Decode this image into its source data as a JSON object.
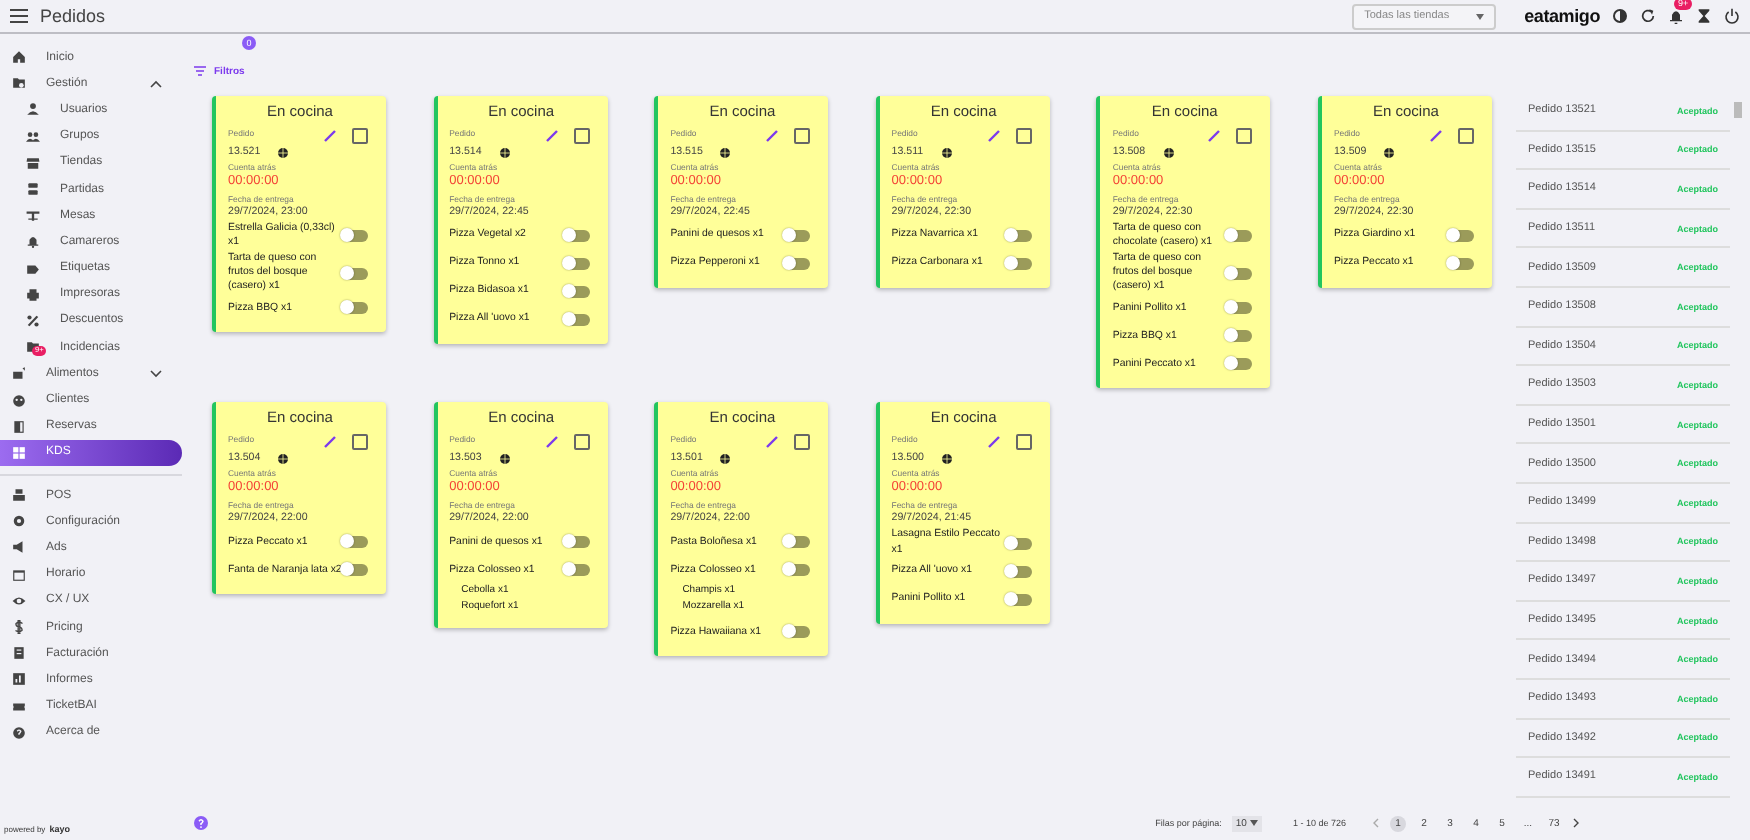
{
  "header": {
    "title": "Pedidos",
    "store_select": {
      "value": "Todas las tiendas"
    },
    "brand": "eatamigo",
    "notification_badge": "9+"
  },
  "sidebar": {
    "items": [
      {
        "label": "Inicio",
        "selected": false
      },
      {
        "label": "Gestión",
        "selected": false,
        "expanded": true,
        "children": [
          {
            "label": "Usuarios",
            "selected": false
          },
          {
            "label": "Grupos",
            "selected": false
          },
          {
            "label": "Tiendas",
            "selected": false
          },
          {
            "label": "Partidas",
            "selected": false
          },
          {
            "label": "Mesas",
            "selected": false
          },
          {
            "label": "Camareros",
            "selected": false
          },
          {
            "label": "Etiquetas",
            "selected": false
          },
          {
            "label": "Impresoras",
            "selected": false
          },
          {
            "label": "Descuentos",
            "selected": false
          },
          {
            "label": "Incidencias",
            "selected": false,
            "badge": "9+"
          }
        ]
      },
      {
        "label": "Alimentos",
        "selected": false,
        "expanded": false
      },
      {
        "label": "Clientes",
        "selected": false
      },
      {
        "label": "Reservas",
        "selected": false
      },
      {
        "label": "KDS",
        "selected": true
      }
    ],
    "bottom_items": [
      {
        "label": "POS",
        "selected": false
      },
      {
        "label": "Configuración",
        "selected": false
      },
      {
        "label": "Ads",
        "selected": false
      },
      {
        "label": "Horario",
        "selected": false
      },
      {
        "label": "CX / UX",
        "selected": false
      },
      {
        "label": "Pricing",
        "selected": false
      },
      {
        "label": "Facturación",
        "selected": false
      },
      {
        "label": "Informes",
        "selected": false
      },
      {
        "label": "TicketBAI",
        "selected": false
      },
      {
        "label": "Acerca de",
        "selected": false
      }
    ],
    "footer": {
      "text": "powered by",
      "brand": "kayo"
    }
  },
  "filters": {
    "label": "Filtros",
    "badge": "0"
  },
  "orders": [
    {
      "status": "En cocina",
      "order_label": "Pedido",
      "number": "13.521",
      "countdown_label": "Cuenta atrás",
      "countdown": "00:00:00",
      "delivery_label": "Fecha de entrega",
      "delivery": "29/7/2024, 23:00",
      "checked": false,
      "items": [
        {
          "name": "Estrella Galicia (0,33cl) x1",
          "done": false
        },
        {
          "name": "Tarta de queso con frutos del bosque (casero) x1",
          "done": false
        },
        {
          "name": "Pizza BBQ x1",
          "done": false
        }
      ]
    },
    {
      "status": "En cocina",
      "order_label": "Pedido",
      "number": "13.514",
      "countdown_label": "Cuenta atrás",
      "countdown": "00:00:00",
      "delivery_label": "Fecha de entrega",
      "delivery": "29/7/2024, 22:45",
      "checked": false,
      "items": [
        {
          "name": "Pizza Vegetal x2",
          "done": false
        },
        {
          "name": "Pizza Tonno x1",
          "done": false
        },
        {
          "name": "Pizza Bidasoa x1",
          "done": false
        },
        {
          "name": "Pizza All 'uovo x1",
          "done": false
        }
      ]
    },
    {
      "status": "En cocina",
      "order_label": "Pedido",
      "number": "13.515",
      "countdown_label": "Cuenta atrás",
      "countdown": "00:00:00",
      "delivery_label": "Fecha de entrega",
      "delivery": "29/7/2024, 22:45",
      "checked": false,
      "items": [
        {
          "name": "Panini de quesos x1",
          "done": false
        },
        {
          "name": "Pizza Pepperoni x1",
          "done": false
        }
      ]
    },
    {
      "status": "En cocina",
      "order_label": "Pedido",
      "number": "13.511",
      "countdown_label": "Cuenta atrás",
      "countdown": "00:00:00",
      "delivery_label": "Fecha de entrega",
      "delivery": "29/7/2024, 22:30",
      "checked": false,
      "items": [
        {
          "name": "Pizza Navarrica x1",
          "done": false
        },
        {
          "name": "Pizza Carbonara x1",
          "done": false
        }
      ]
    },
    {
      "status": "En cocina",
      "order_label": "Pedido",
      "number": "13.508",
      "countdown_label": "Cuenta atrás",
      "countdown": "00:00:00",
      "delivery_label": "Fecha de entrega",
      "delivery": "29/7/2024, 22:30",
      "checked": false,
      "items": [
        {
          "name": "Tarta de queso con chocolate (casero) x1",
          "done": false
        },
        {
          "name": "Tarta de queso con frutos del bosque (casero) x1",
          "done": false
        },
        {
          "name": "Panini Pollito x1",
          "done": false
        },
        {
          "name": "Pizza BBQ x1",
          "done": false
        },
        {
          "name": "Panini Peccato x1",
          "done": false
        }
      ]
    },
    {
      "status": "En cocina",
      "order_label": "Pedido",
      "number": "13.509",
      "countdown_label": "Cuenta atrás",
      "countdown": "00:00:00",
      "delivery_label": "Fecha de entrega",
      "delivery": "29/7/2024, 22:30",
      "checked": false,
      "items": [
        {
          "name": "Pizza Giardino x1",
          "done": false
        },
        {
          "name": "Pizza Peccato x1",
          "done": false
        }
      ]
    },
    {
      "status": "En cocina",
      "order_label": "Pedido",
      "number": "13.504",
      "countdown_label": "Cuenta atrás",
      "countdown": "00:00:00",
      "delivery_label": "Fecha de entrega",
      "delivery": "29/7/2024, 22:00",
      "checked": false,
      "items": [
        {
          "name": "Pizza Peccato x1",
          "done": false
        },
        {
          "name": "Fanta de Naranja lata x2",
          "done": false
        }
      ]
    },
    {
      "status": "En cocina",
      "order_label": "Pedido",
      "number": "13.503",
      "countdown_label": "Cuenta atrás",
      "countdown": "00:00:00",
      "delivery_label": "Fecha de entrega",
      "delivery": "29/7/2024, 22:00",
      "checked": false,
      "items": [
        {
          "name": "Panini de quesos x1",
          "done": false
        },
        {
          "name": "Pizza Colosseo x1",
          "done": false,
          "extras": [
            "Cebolla x1",
            "Roquefort x1"
          ]
        }
      ]
    },
    {
      "status": "En cocina",
      "order_label": "Pedido",
      "number": "13.501",
      "countdown_label": "Cuenta atrás",
      "countdown": "00:00:00",
      "delivery_label": "Fecha de entrega",
      "delivery": "29/7/2024, 22:00",
      "checked": false,
      "items": [
        {
          "name": "Pasta Boloñesa x1",
          "done": false
        },
        {
          "name": "Pizza Colosseo x1",
          "done": false,
          "extras": [
            "Champis x1",
            "Mozzarella x1"
          ]
        },
        {
          "name": "Pizza Hawaiiana x1",
          "done": false
        }
      ]
    },
    {
      "status": "En cocina",
      "order_label": "Pedido",
      "number": "13.500",
      "countdown_label": "Cuenta atrás",
      "countdown": "00:00:00",
      "delivery_label": "Fecha de entrega",
      "delivery": "29/7/2024, 21:45",
      "checked": false,
      "items": [
        {
          "name": "Lasagna Estilo Peccato x1",
          "done": false
        },
        {
          "name": "Pizza All 'uovo x1",
          "done": false
        },
        {
          "name": "Panini Pollito x1",
          "done": false
        }
      ]
    }
  ],
  "order_list": [
    {
      "name": "Pedido 13521",
      "status": "Aceptado"
    },
    {
      "name": "Pedido 13515",
      "status": "Aceptado"
    },
    {
      "name": "Pedido 13514",
      "status": "Aceptado"
    },
    {
      "name": "Pedido 13511",
      "status": "Aceptado"
    },
    {
      "name": "Pedido 13509",
      "status": "Aceptado"
    },
    {
      "name": "Pedido 13508",
      "status": "Aceptado"
    },
    {
      "name": "Pedido 13504",
      "status": "Aceptado"
    },
    {
      "name": "Pedido 13503",
      "status": "Aceptado"
    },
    {
      "name": "Pedido 13501",
      "status": "Aceptado"
    },
    {
      "name": "Pedido 13500",
      "status": "Aceptado"
    },
    {
      "name": "Pedido 13499",
      "status": "Aceptado"
    },
    {
      "name": "Pedido 13498",
      "status": "Aceptado"
    },
    {
      "name": "Pedido 13497",
      "status": "Aceptado"
    },
    {
      "name": "Pedido 13495",
      "status": "Aceptado"
    },
    {
      "name": "Pedido 13494",
      "status": "Aceptado"
    },
    {
      "name": "Pedido 13493",
      "status": "Aceptado"
    },
    {
      "name": "Pedido 13492",
      "status": "Aceptado"
    },
    {
      "name": "Pedido 13491",
      "status": "Aceptado"
    }
  ],
  "pagination": {
    "rows_label": "Filas por página:",
    "rows_value": "10",
    "range": "1 - 10 de 726",
    "pages": [
      {
        "label": "1",
        "selected": true
      },
      {
        "label": "2",
        "selected": false
      },
      {
        "label": "3",
        "selected": false
      },
      {
        "label": "4",
        "selected": false
      },
      {
        "label": "5",
        "selected": false
      },
      {
        "label": "...",
        "selected": false
      },
      {
        "label": "73",
        "selected": false
      }
    ]
  }
}
